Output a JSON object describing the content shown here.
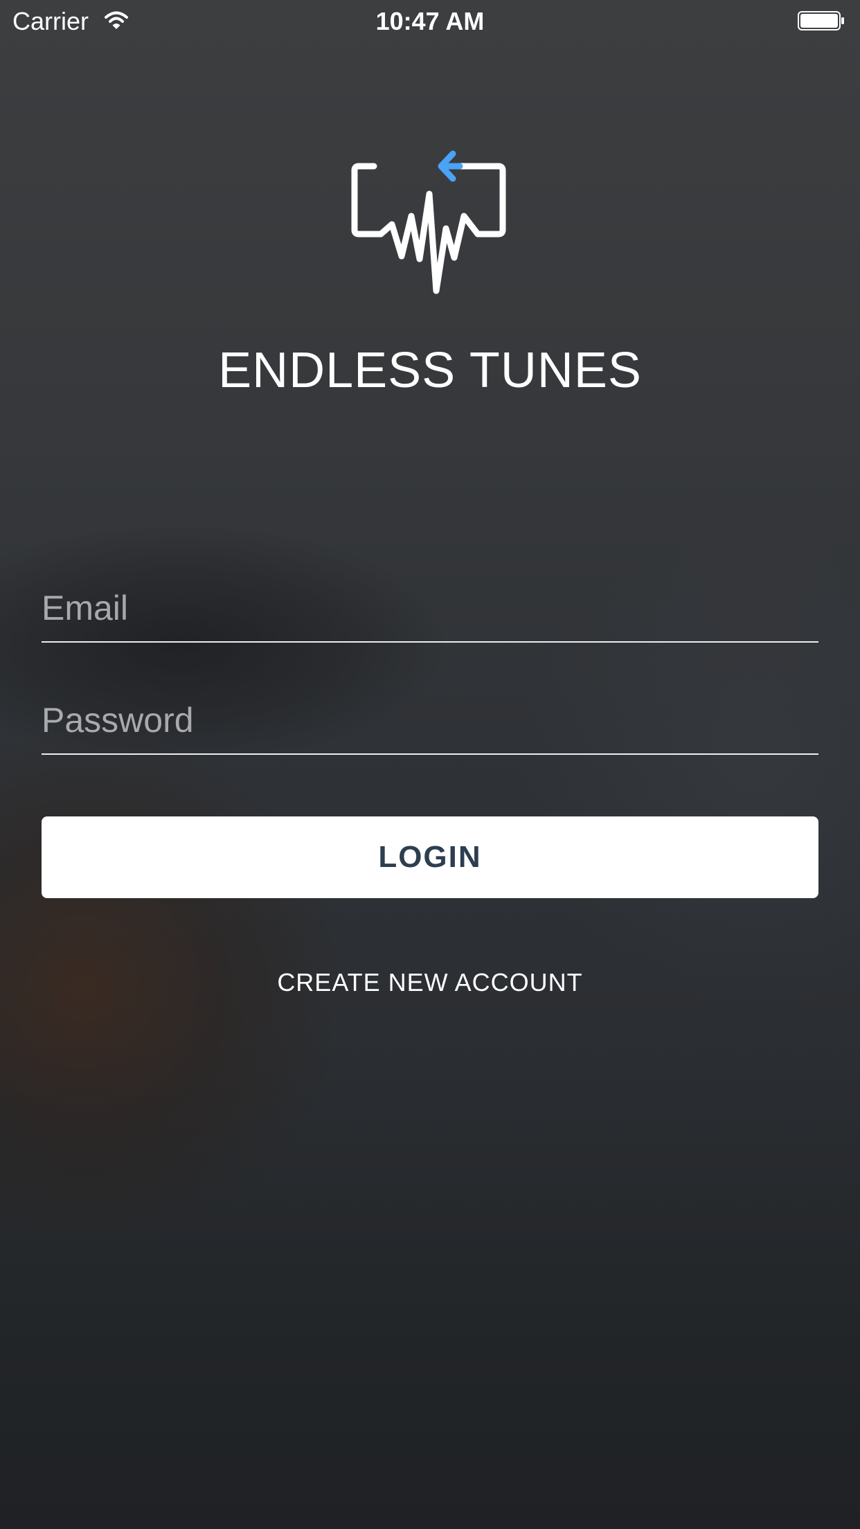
{
  "status_bar": {
    "carrier": "Carrier",
    "wifi_icon": "wifi-icon",
    "time": "10:47 AM",
    "battery_icon": "battery-icon"
  },
  "app": {
    "logo_icon": "endless-tunes-logo-icon",
    "title": "ENDLESS TUNES"
  },
  "form": {
    "email_placeholder": "Email",
    "email_value": "",
    "password_placeholder": "Password",
    "password_value": "",
    "login_label": "LOGIN",
    "create_account_label": "CREATE NEW ACCOUNT"
  },
  "colors": {
    "accent": "#4aa3f5",
    "button_text": "#2c3e50",
    "button_background": "#ffffff"
  }
}
